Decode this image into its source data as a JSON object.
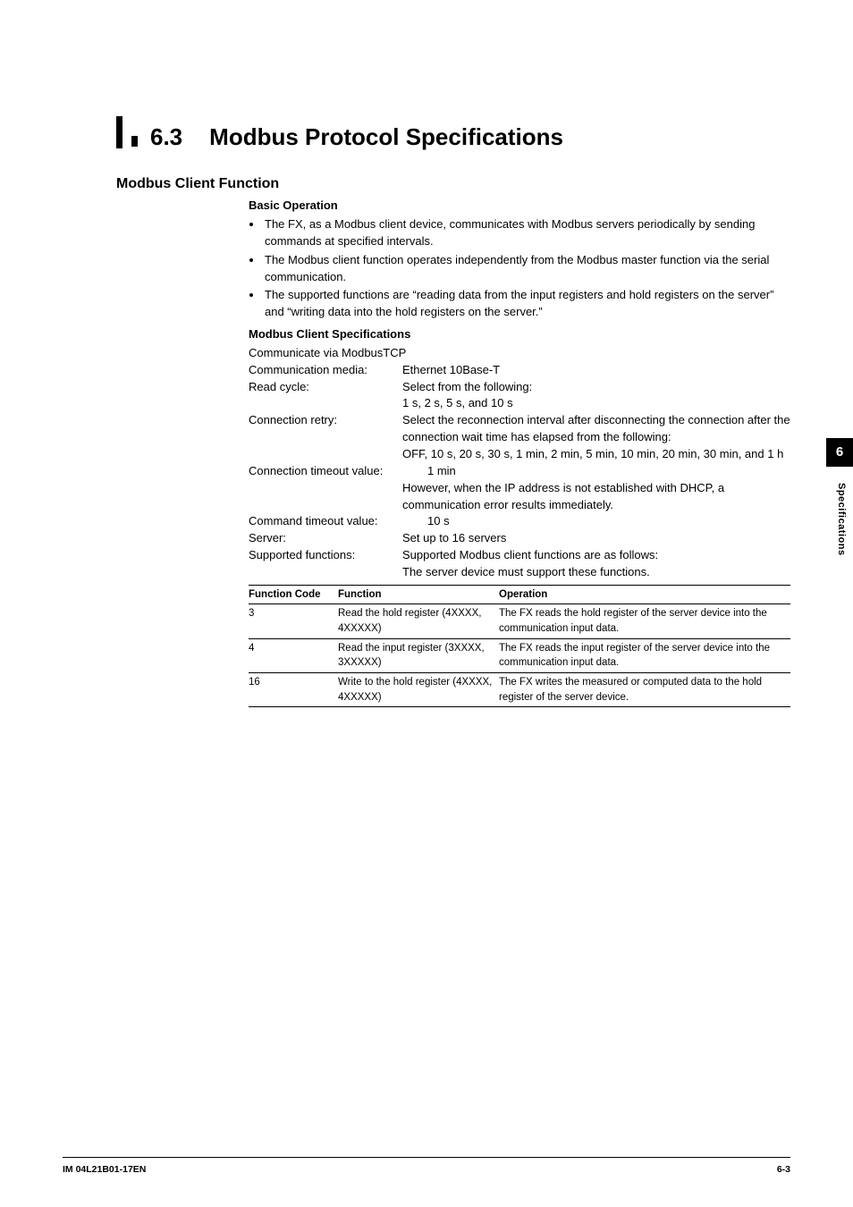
{
  "section": {
    "number": "6.3",
    "title": "Modbus Protocol Specifications"
  },
  "h2": "Modbus Client Function",
  "basic": {
    "heading": "Basic Operation",
    "bullets": [
      "The FX, as a Modbus client device, communicates with Modbus servers periodically by sending commands at specified intervals.",
      "The Modbus client function operates independently from the Modbus master function via the serial communication.",
      "The supported functions are “reading data from the input registers and hold registers on the server” and “writing data into the hold registers on the server.”"
    ]
  },
  "specs": {
    "heading": "Modbus Client Specifications",
    "intro": "Communicate via ModbusTCP",
    "rows": {
      "media_label": "Communication media:",
      "media_val": "Ethernet 10Base-T",
      "readcycle_label": "Read cycle:",
      "readcycle_val1": "Select from the following:",
      "readcycle_val2": "1 s, 2 s, 5 s, and 10 s",
      "retry_label": "Connection retry:",
      "retry_val1": "Select the reconnection interval after disconnecting the connection after the connection wait time has elapsed from the following:",
      "retry_val2": "OFF, 10 s, 20 s, 30 s, 1 min, 2 min, 5 min, 10 min, 20 min, 30 min, and 1 h",
      "cto_label": "Connection timeout value:",
      "cto_val1": "1 min",
      "cto_val2": "However, when the IP address is not established with DHCP, a communication error results immediately.",
      "cmdto_label": "Command timeout value:",
      "cmdto_val": "10 s",
      "server_label": "Server:",
      "server_val": "Set up to 16 servers",
      "supfn_label": "Supported functions:",
      "supfn_val1": "Supported Modbus client functions are as follows:",
      "supfn_val2": "The server device must support these functions."
    }
  },
  "table": {
    "h1": "Function Code",
    "h2": "Function",
    "h3": "Operation",
    "r1": {
      "code": "3",
      "fn": "Read the hold register (4XXXX, 4XXXXX)",
      "op": "The FX reads the hold register of the server device into the communication input data."
    },
    "r2": {
      "code": "4",
      "fn": "Read the input register (3XXXX, 3XXXXX)",
      "op": "The FX reads the input register of the server device into the communication input data."
    },
    "r3": {
      "code": "16",
      "fn": "Write to the hold register (4XXXX, 4XXXXX)",
      "op": "The FX writes the measured or computed data to the hold register of the server device."
    }
  },
  "side": {
    "chapter": "6",
    "label": "Specifications"
  },
  "footer": {
    "left": "IM 04L21B01-17EN",
    "right": "6-3"
  }
}
